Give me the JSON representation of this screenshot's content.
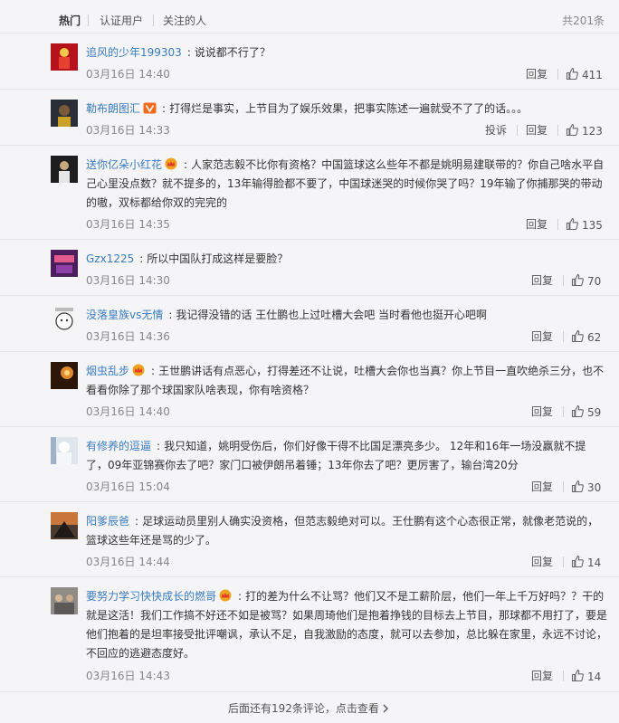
{
  "tabs": [
    {
      "label": "热门",
      "active": true
    },
    {
      "label": "认证用户",
      "active": false
    },
    {
      "label": "关注的人",
      "active": false
    }
  ],
  "total": "共201条",
  "colors": {
    "username": "#3a7bbf",
    "crown": "#f0a21e",
    "vip": "#f26b1d"
  },
  "comments": [
    {
      "user": "追风的少年199303",
      "badge": "",
      "text": "说说都不行了？",
      "time": "03月16日 14:40",
      "report": "",
      "reply": "回复",
      "likes": "411",
      "avatar_icon": "red-figure-avatar"
    },
    {
      "user": "勒布朗图汇",
      "badge": "vip",
      "text": "打得烂是事实，上节目为了娱乐效果，把事实陈述一遍就受不了了的话。。。",
      "time": "03月16日 14:33",
      "report": "投诉",
      "reply": "回复",
      "likes": "123",
      "avatar_icon": "player-avatar"
    },
    {
      "user": "送你亿朵小红花",
      "badge": "crown",
      "text": "人家范志毅不比你有资格？中国篮球这么些年不都是姚明易建联带的？你自己啥水平自己心里没点数？就不提多的，13年输得脸都不要了，中国球迷哭的时候你哭了吗？19年输了你捕那哭的带动的嗷，双标都给你双的完完的",
      "time": "03月16日 14:35",
      "report": "",
      "reply": "回复",
      "likes": "135",
      "avatar_icon": "dark-portrait-avatar"
    },
    {
      "user": "Gzx1225",
      "badge": "",
      "text": "所以中国队打成这样是要脸？",
      "time": "03月16日 14:30",
      "report": "",
      "reply": "回复",
      "likes": "70",
      "avatar_icon": "purple-poster-avatar"
    },
    {
      "user": "没落皇族vs无情",
      "badge": "",
      "text": "我记得没错的话 王仕鹏也上过吐槽大会吧 当时看他也挺开心吧啊",
      "time": "03月16日 14:36",
      "report": "",
      "reply": "回复",
      "likes": "62",
      "avatar_icon": "cartoon-face-avatar"
    },
    {
      "user": "烟虫乱步",
      "badge": "crown",
      "text": "王世鹏讲话有点恶心，打得差还不让说，吐槽大会你也当真？你上节目一直吹绝杀三分，也不看看你除了那个球国家队啥表现，你有啥资格？",
      "time": "03月16日 14:40",
      "report": "",
      "reply": "回复",
      "likes": "59",
      "avatar_icon": "warm-light-avatar"
    },
    {
      "user": "有修养的逗逼",
      "badge": "",
      "text": "我只知道，姚明受伤后，你们好像干得不比国足漂亮多少。 12年和16年一场没赢就不提了，09年亚锦赛你去了吧？家门口被伊朗吊着锤；13年你去了吧？更厉害了，输台湾20分",
      "time": "03月16日 15:04",
      "report": "",
      "reply": "回复",
      "likes": "30",
      "avatar_icon": "white-figure-avatar"
    },
    {
      "user": "阳爹辰爸",
      "badge": "",
      "text": "足球运动员里别人确实没资格，但范志毅绝对可以。王仕鹏有这个心态很正常，就像老范说的，篮球这些年还是骂的少了。",
      "time": "03月16日 14:44",
      "report": "",
      "reply": "回复",
      "likes": "14",
      "avatar_icon": "sunset-pyramid-avatar"
    },
    {
      "user": "要努力学习快快成长的燃哥",
      "badge": "crown",
      "text": "打的差为什么不让骂？他们又不是工薪阶层，他们一年上千万好吗？？干的就是这活！我们工作搞不好还不如是被骂？如果周琦他们是抱着挣钱的目标去上节目，那球都不用打了，要是他们抱着的是坦率接受批评嘲讽，承认不足，自我激励的态度，就可以去参加，总比躲在家里，永远不讨论，不回应的逃避态度好。",
      "time": "03月16日 14:43",
      "report": "",
      "reply": "回复",
      "likes": "14",
      "avatar_icon": "crowd-photo-avatar"
    }
  ],
  "more": "后面还有192条评论，点击查看"
}
